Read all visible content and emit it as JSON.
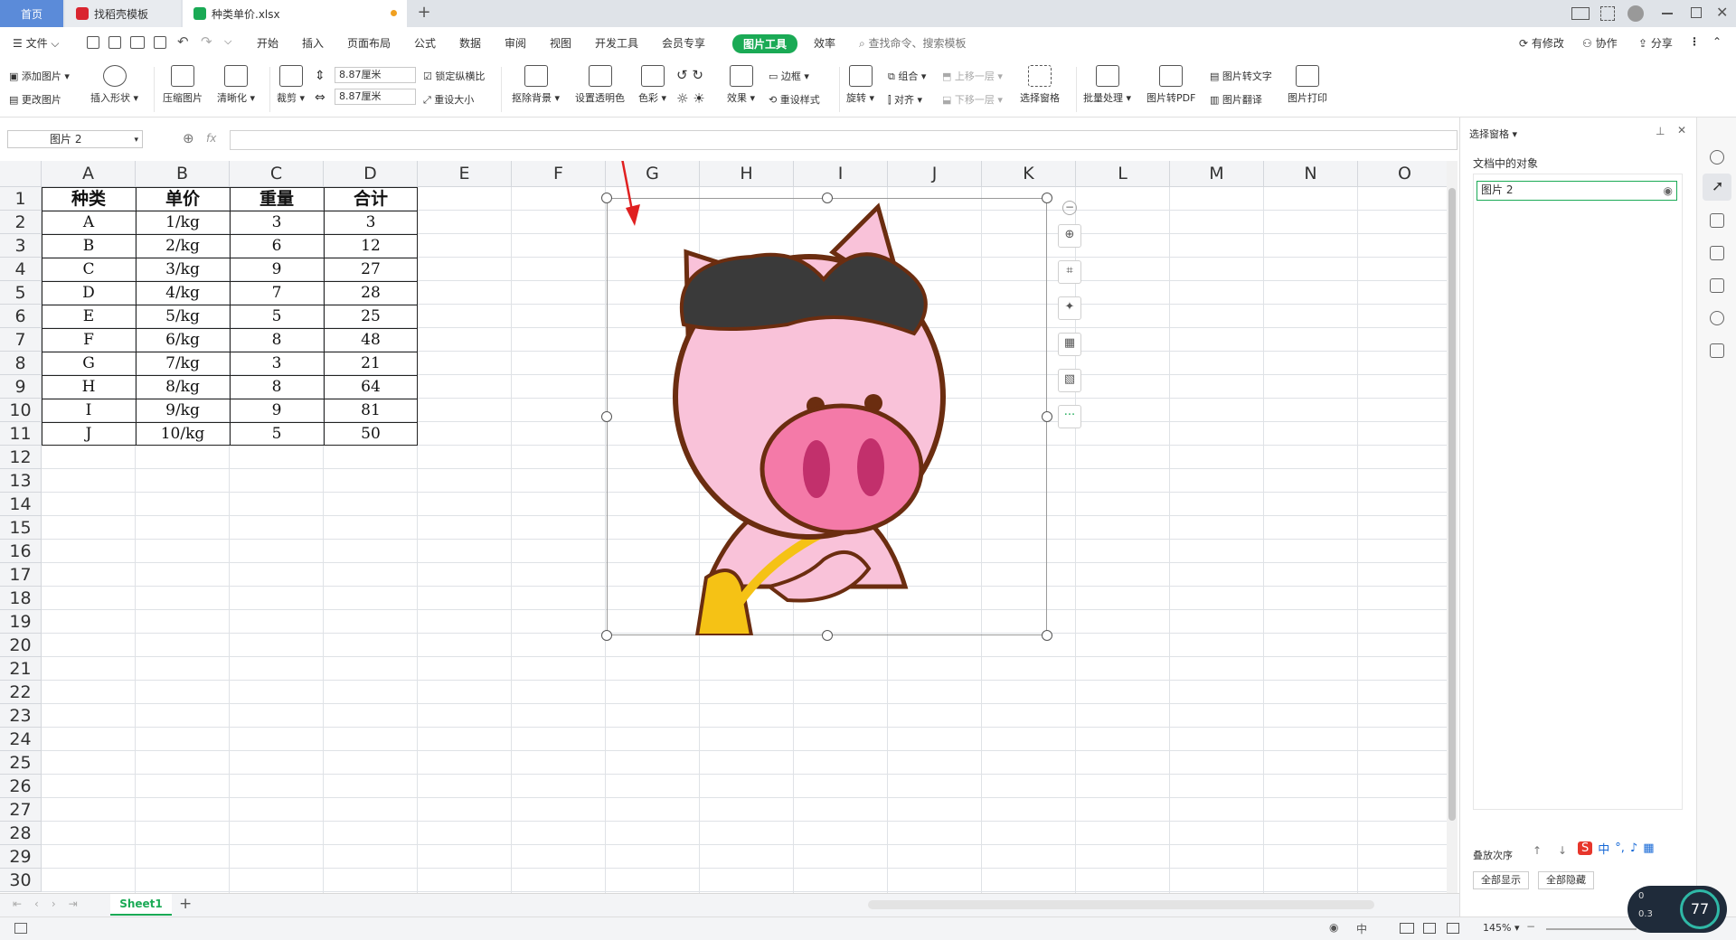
{
  "tabs": {
    "home": "首页",
    "template": "找稻壳模板",
    "file": "种类单价.xlsx",
    "new_tab": "+"
  },
  "menubar": {
    "file_menu": "文件",
    "items": [
      "开始",
      "插入",
      "页面布局",
      "公式",
      "数据",
      "审阅",
      "视图",
      "开发工具",
      "会员专享",
      "图片工具",
      "效率"
    ],
    "active": "图片工具",
    "search": "查找命令、搜索模板",
    "has_changes": "有修改",
    "collab": "协作",
    "share": "分享"
  },
  "ribbon": {
    "add_picture": "添加图片",
    "change_picture": "更改图片",
    "insert_shape": "插入形状",
    "compress": "压缩图片",
    "sharpen": "清晰化",
    "crop": "裁剪",
    "height": "8.87厘米",
    "width": "8.87厘米",
    "lock_ratio": "锁定纵横比",
    "reset_size": "重设大小",
    "remove_bg": "抠除背景",
    "set_transparent": "设置透明色",
    "color": "色彩",
    "effects": "效果",
    "border": "边框",
    "reset_style": "重设样式",
    "rotate": "旋转",
    "group": "组合",
    "align": "对齐",
    "bring_forward": "上移一层",
    "send_backward": "下移一层",
    "selection_pane": "选择窗格",
    "batch": "批量处理",
    "to_pdf": "图片转PDF",
    "to_text": "图片转文字",
    "translate": "图片翻译",
    "print": "图片打印"
  },
  "formula_bar": {
    "name_box": "图片 2",
    "fx": "fx",
    "value": ""
  },
  "columns": [
    "A",
    "B",
    "C",
    "D",
    "E",
    "F",
    "G",
    "H",
    "I",
    "J",
    "K",
    "L",
    "M",
    "N",
    "O"
  ],
  "rows": [
    "1",
    "2",
    "3",
    "4",
    "5",
    "6",
    "7",
    "8",
    "9",
    "10",
    "11",
    "12",
    "13",
    "14",
    "15",
    "16",
    "17",
    "18",
    "19",
    "20",
    "21",
    "22",
    "23",
    "24",
    "25",
    "26",
    "27",
    "28",
    "29",
    "30"
  ],
  "table": {
    "headers": [
      "种类",
      "单价",
      "重量",
      "合计"
    ],
    "rows": [
      [
        "A",
        "1/kg",
        "3",
        "3"
      ],
      [
        "B",
        "2/kg",
        "6",
        "12"
      ],
      [
        "C",
        "3/kg",
        "9",
        "27"
      ],
      [
        "D",
        "4/kg",
        "7",
        "28"
      ],
      [
        "E",
        "5/kg",
        "5",
        "25"
      ],
      [
        "F",
        "6/kg",
        "8",
        "48"
      ],
      [
        "G",
        "7/kg",
        "3",
        "21"
      ],
      [
        "H",
        "8/kg",
        "8",
        "64"
      ],
      [
        "I",
        "9/kg",
        "9",
        "81"
      ],
      [
        "J",
        "10/kg",
        "5",
        "50"
      ]
    ]
  },
  "sheet": {
    "name": "Sheet1",
    "add": "+"
  },
  "side_pane": {
    "title": "选择窗格",
    "objects_label": "文档中的对象",
    "object": "图片 2",
    "order_label": "叠放次序",
    "show_all": "全部显示",
    "hide_all": "全部隐藏"
  },
  "status": {
    "zoom": "145%",
    "input_mode": "中",
    "speed_top": "0",
    "speed_bottom": "0.3",
    "speed_percent": "77"
  },
  "colors": {
    "accent": "#1aaa55",
    "home_tab": "#5b8bd9",
    "pig_pink": "#f9c2d9",
    "pig_nose": "#f47aa8",
    "annotation_arrow": "#e02020"
  }
}
